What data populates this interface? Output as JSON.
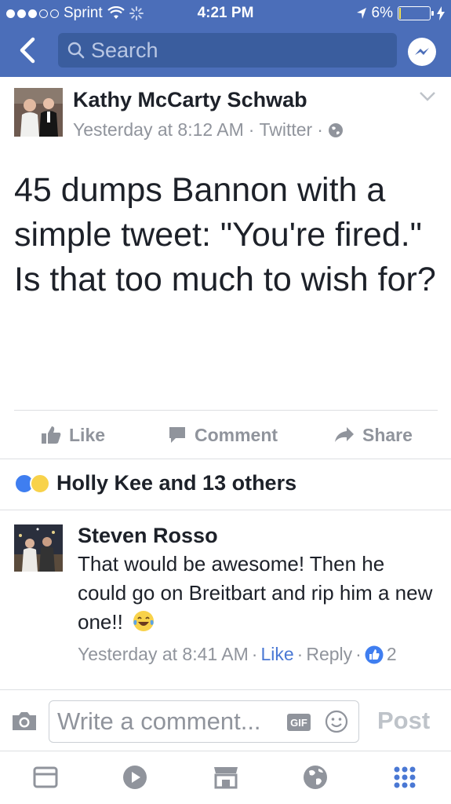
{
  "status_bar": {
    "carrier": "Sprint",
    "time": "4:21 PM",
    "battery": "6%",
    "battery_level": 0.06
  },
  "search": {
    "placeholder": "Search"
  },
  "post": {
    "author": "Kathy McCarty Schwab",
    "timestamp": "Yesterday at 8:12 AM",
    "source": "Twitter",
    "text": "45 dumps Bannon with a simple tweet: \"You're fired.\"\nIs that too much to wish for?"
  },
  "actions": {
    "like": "Like",
    "comment": "Comment",
    "share": "Share"
  },
  "reactions": {
    "summary": "Holly Kee and 13 others"
  },
  "comment": {
    "author": "Steven Rosso",
    "text": "That would be awesome! Then he could go on Breitbart and rip him a new one!!",
    "timestamp": "Yesterday at 8:41 AM",
    "like": "Like",
    "reply": "Reply",
    "like_count": "2"
  },
  "composer": {
    "placeholder": "Write a comment...",
    "gif": "GIF",
    "post": "Post"
  },
  "colors": {
    "header": "#4b6eb9",
    "accent": "#4a78d4",
    "muted": "#90949c"
  },
  "tab_bar": {
    "icons": [
      "news-feed-icon",
      "video-icon",
      "marketplace-icon",
      "notifications-globe-icon",
      "more-menu-icon"
    ]
  }
}
